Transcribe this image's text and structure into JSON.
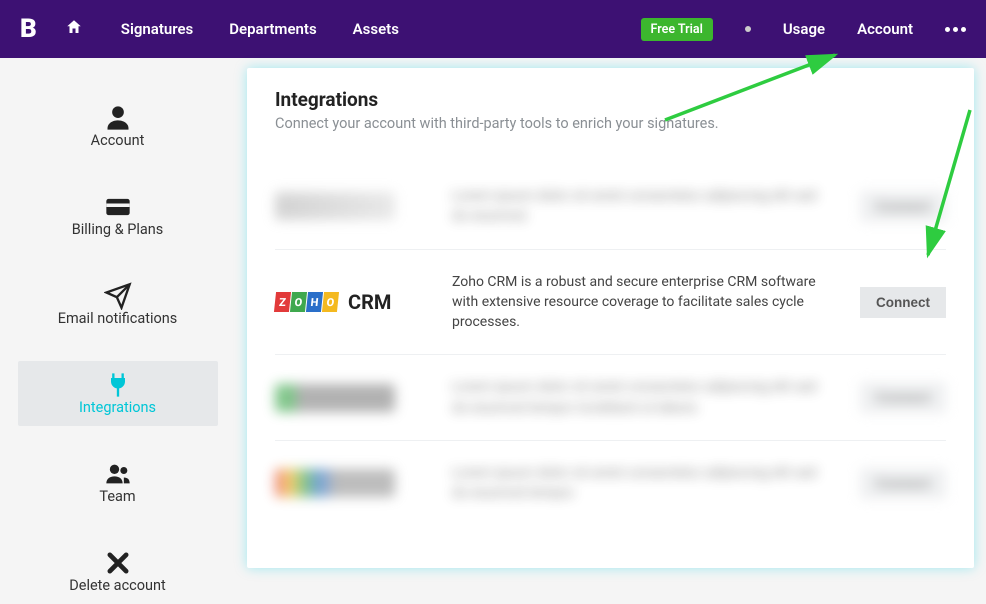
{
  "nav": {
    "logo": "B",
    "items": [
      "Signatures",
      "Departments",
      "Assets"
    ],
    "free_trial": "Free Trial",
    "usage": "Usage",
    "account": "Account"
  },
  "sidebar": {
    "items": [
      {
        "label": "Account"
      },
      {
        "label": "Billing & Plans"
      },
      {
        "label": "Email notifications"
      },
      {
        "label": "Integrations"
      },
      {
        "label": "Team"
      },
      {
        "label": "Delete account"
      }
    ]
  },
  "panel": {
    "title": "Integrations",
    "subtitle": "Connect your account with third-party tools to enrich your signatures."
  },
  "integrations": {
    "zoho": {
      "name": "CRM",
      "description": "Zoho CRM is a robust and secure enterprise CRM software with extensive resource coverage to facilitate sales cycle processes.",
      "button": "Connect"
    },
    "blurred_button": "Connect"
  }
}
